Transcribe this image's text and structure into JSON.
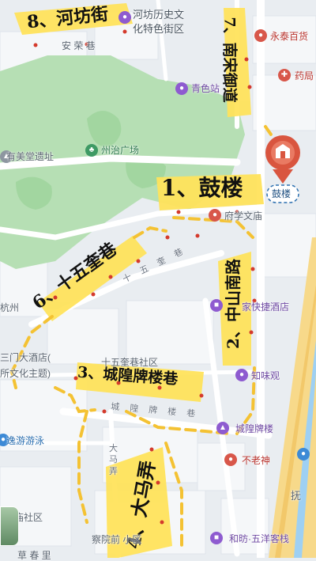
{
  "route_labels": {
    "r1": "1、鼓楼",
    "r2": "2、中山南路",
    "r3": "3、城隍牌楼巷",
    "r4": "4、大马弄",
    "r6": "6、十五奎巷",
    "r7": "7、南宋御道",
    "r8": "8、河坊街"
  },
  "pois": {
    "hefang_culture": "河坊历史文\n化特色街区",
    "yongtai": "永泰百货",
    "pharmacy": "药局",
    "qingse": "青色站",
    "nansong_site": "有美堂遗址",
    "zhouzhi": "州治广场",
    "gulou_tag": "鼓楼",
    "fuxue_site": "府学文庙",
    "hangzhou_left": "杭州",
    "jiayuan_hotel": "家快捷酒店",
    "sanmen_hotel": "三门大酒店(",
    "culture_theme": "所文化主题)",
    "zhiweiguan": "知味观",
    "chenghuang_pailou": "城隍牌楼",
    "bulaoshen": "不老神",
    "yiyou_swim": "逸游游泳",
    "hefang_wuyang": "和昉·五洋客栈",
    "fu_lu": "抚"
  },
  "areas": {
    "anrong": "安 荣 巷",
    "shiwukui_community": "十五奎巷社区",
    "miao_community": "庙社区",
    "yuanqian_community": "察院前 小区",
    "bottom_cut": "草 春 里"
  },
  "streets": {
    "shiwukui": "十 五 奎 巷",
    "chenghuang": "城 隍 牌 楼 巷",
    "dama": "大\n马\n弄"
  },
  "colors": {
    "highlight": "#ffe35c",
    "dash": "#f4c233",
    "park": "#b6dfb4",
    "road_main": "#f7d98a",
    "water": "#9ed0f3",
    "pin": "#d9553f"
  }
}
